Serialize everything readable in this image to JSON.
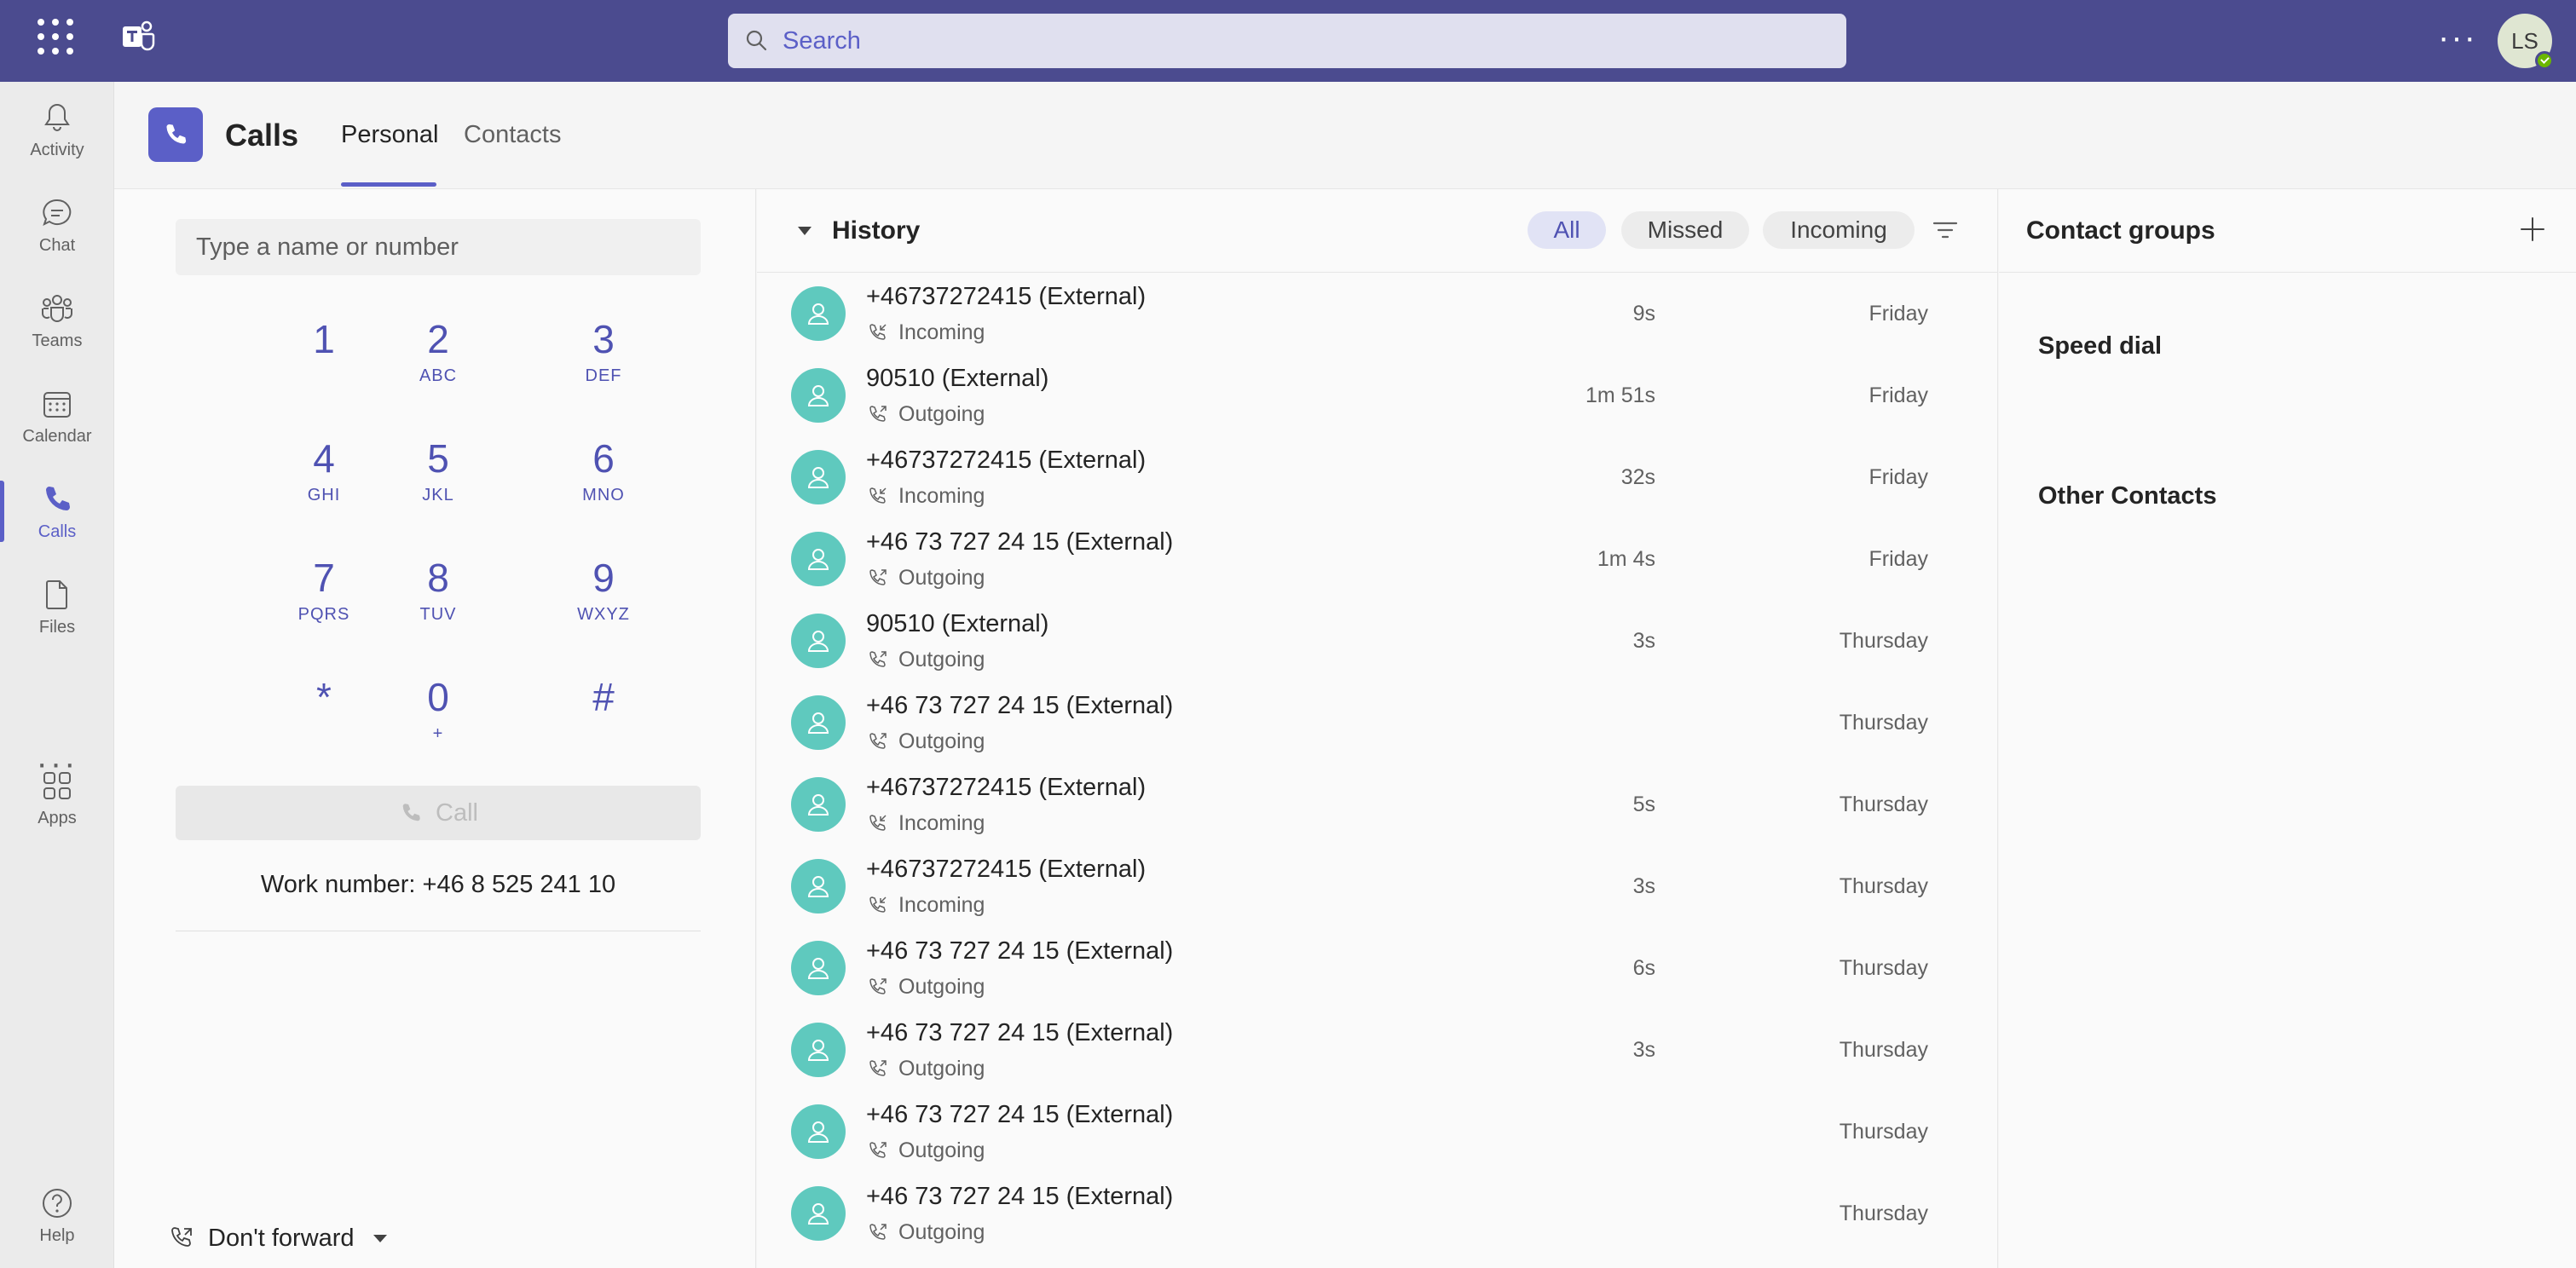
{
  "topbar": {
    "search_placeholder": "Search",
    "avatar_initials": "LS"
  },
  "rail": {
    "items": [
      {
        "label": "Activity",
        "icon": "bell-icon"
      },
      {
        "label": "Chat",
        "icon": "chat-icon"
      },
      {
        "label": "Teams",
        "icon": "teams-icon"
      },
      {
        "label": "Calendar",
        "icon": "calendar-icon"
      },
      {
        "label": "Calls",
        "icon": "phone-icon"
      },
      {
        "label": "Files",
        "icon": "file-icon"
      },
      {
        "label": "Apps",
        "icon": "apps-icon"
      },
      {
        "label": "Help",
        "icon": "help-icon"
      }
    ],
    "more": "···"
  },
  "header": {
    "title": "Calls",
    "tabs": [
      "Personal",
      "Contacts"
    ]
  },
  "dialpad": {
    "input_placeholder": "Type a name or number",
    "keys": [
      {
        "digit": "1",
        "letters": ""
      },
      {
        "digit": "2",
        "letters": "ABC"
      },
      {
        "digit": "3",
        "letters": "DEF"
      },
      {
        "digit": "4",
        "letters": "GHI"
      },
      {
        "digit": "5",
        "letters": "JKL"
      },
      {
        "digit": "6",
        "letters": "MNO"
      },
      {
        "digit": "7",
        "letters": "PQRS"
      },
      {
        "digit": "8",
        "letters": "TUV"
      },
      {
        "digit": "9",
        "letters": "WXYZ"
      },
      {
        "digit": "*",
        "letters": ""
      },
      {
        "digit": "0",
        "letters": "+"
      },
      {
        "digit": "#",
        "letters": ""
      }
    ],
    "call_label": "Call",
    "work_number": "Work number: +46 8 525 241 10",
    "forward_label": "Don't forward"
  },
  "history": {
    "title": "History",
    "filters": [
      "All",
      "Missed",
      "Incoming"
    ],
    "rows": [
      {
        "name": "+46737272415 (External)",
        "direction": "Incoming",
        "duration": "9s",
        "day": "Friday"
      },
      {
        "name": "90510 (External)",
        "direction": "Outgoing",
        "duration": "1m 51s",
        "day": "Friday"
      },
      {
        "name": "+46737272415 (External)",
        "direction": "Incoming",
        "duration": "32s",
        "day": "Friday"
      },
      {
        "name": "+46 73 727 24 15 (External)",
        "direction": "Outgoing",
        "duration": "1m 4s",
        "day": "Friday"
      },
      {
        "name": "90510 (External)",
        "direction": "Outgoing",
        "duration": "3s",
        "day": "Thursday"
      },
      {
        "name": "+46 73 727 24 15 (External)",
        "direction": "Outgoing",
        "duration": "",
        "day": "Thursday"
      },
      {
        "name": "+46737272415 (External)",
        "direction": "Incoming",
        "duration": "5s",
        "day": "Thursday"
      },
      {
        "name": "+46737272415 (External)",
        "direction": "Incoming",
        "duration": "3s",
        "day": "Thursday"
      },
      {
        "name": "+46 73 727 24 15 (External)",
        "direction": "Outgoing",
        "duration": "6s",
        "day": "Thursday"
      },
      {
        "name": "+46 73 727 24 15 (External)",
        "direction": "Outgoing",
        "duration": "3s",
        "day": "Thursday"
      },
      {
        "name": "+46 73 727 24 15 (External)",
        "direction": "Outgoing",
        "duration": "",
        "day": "Thursday"
      },
      {
        "name": "+46 73 727 24 15 (External)",
        "direction": "Outgoing",
        "duration": "",
        "day": "Thursday"
      }
    ]
  },
  "contacts": {
    "title": "Contact groups",
    "sections": [
      "Speed dial",
      "Other Contacts"
    ]
  },
  "colors": {
    "brand": "#4b4b8f",
    "accent": "#5b5fc7",
    "avatar_teal": "#5fc9be"
  }
}
